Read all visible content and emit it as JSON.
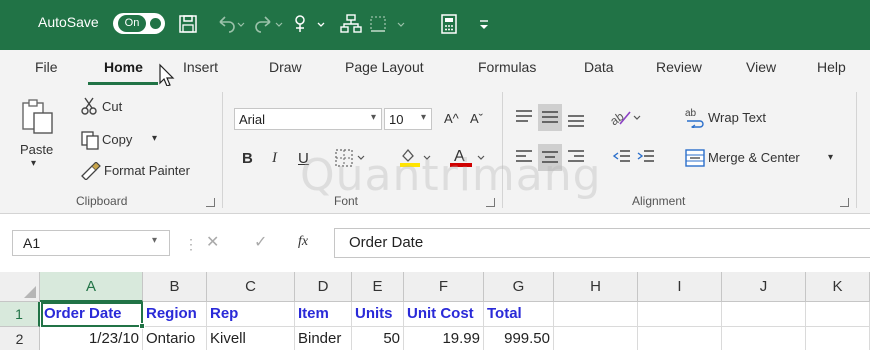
{
  "titlebar": {
    "autosave_label": "AutoSave",
    "autosave_state": "On",
    "bg_color": "#217346",
    "quick_access_icons": [
      "save-icon",
      "undo-icon",
      "redo-icon",
      "touch-mode-icon",
      "sort-icon",
      "border-icon",
      "calculator-icon",
      "customize-qat-icon"
    ]
  },
  "tabs": {
    "items": [
      "File",
      "Home",
      "Insert",
      "Draw",
      "Page Layout",
      "Formulas",
      "Data",
      "Review",
      "View",
      "Help"
    ],
    "active": "Home"
  },
  "ribbon": {
    "clipboard": {
      "label": "Clipboard",
      "paste": "Paste",
      "cut": "Cut",
      "copy": "Copy",
      "format_painter": "Format Painter"
    },
    "font": {
      "label": "Font",
      "font_name": "Arial",
      "font_size": "10",
      "grow_font": "A^",
      "shrink_font": "Aˇ",
      "bold": "B",
      "italic": "I",
      "underline": "U",
      "font_color": "A",
      "highlight_color": "#ffe400",
      "text_color": "#d00000"
    },
    "alignment": {
      "label": "Alignment",
      "wrap_text": "Wrap Text",
      "merge_center": "Merge & Center"
    }
  },
  "watermark": "Quantrimang",
  "formula_bar": {
    "name_box": "A1",
    "fx": "fx",
    "content": "Order Date"
  },
  "grid": {
    "columns": [
      "A",
      "B",
      "C",
      "D",
      "E",
      "F",
      "G",
      "H",
      "I",
      "J",
      "K"
    ],
    "selected_column": "A",
    "rows": [
      "1",
      "2"
    ],
    "selected_row": "1",
    "row1": [
      "Order Date",
      "Region",
      "Rep",
      "Item",
      "Units",
      "Unit Cost",
      "Total"
    ],
    "row2": [
      "1/23/10",
      "Ontario",
      "Kivell",
      "Binder",
      "50",
      "19.99",
      "999.50"
    ],
    "header_text_color": "#2a2ad8"
  }
}
